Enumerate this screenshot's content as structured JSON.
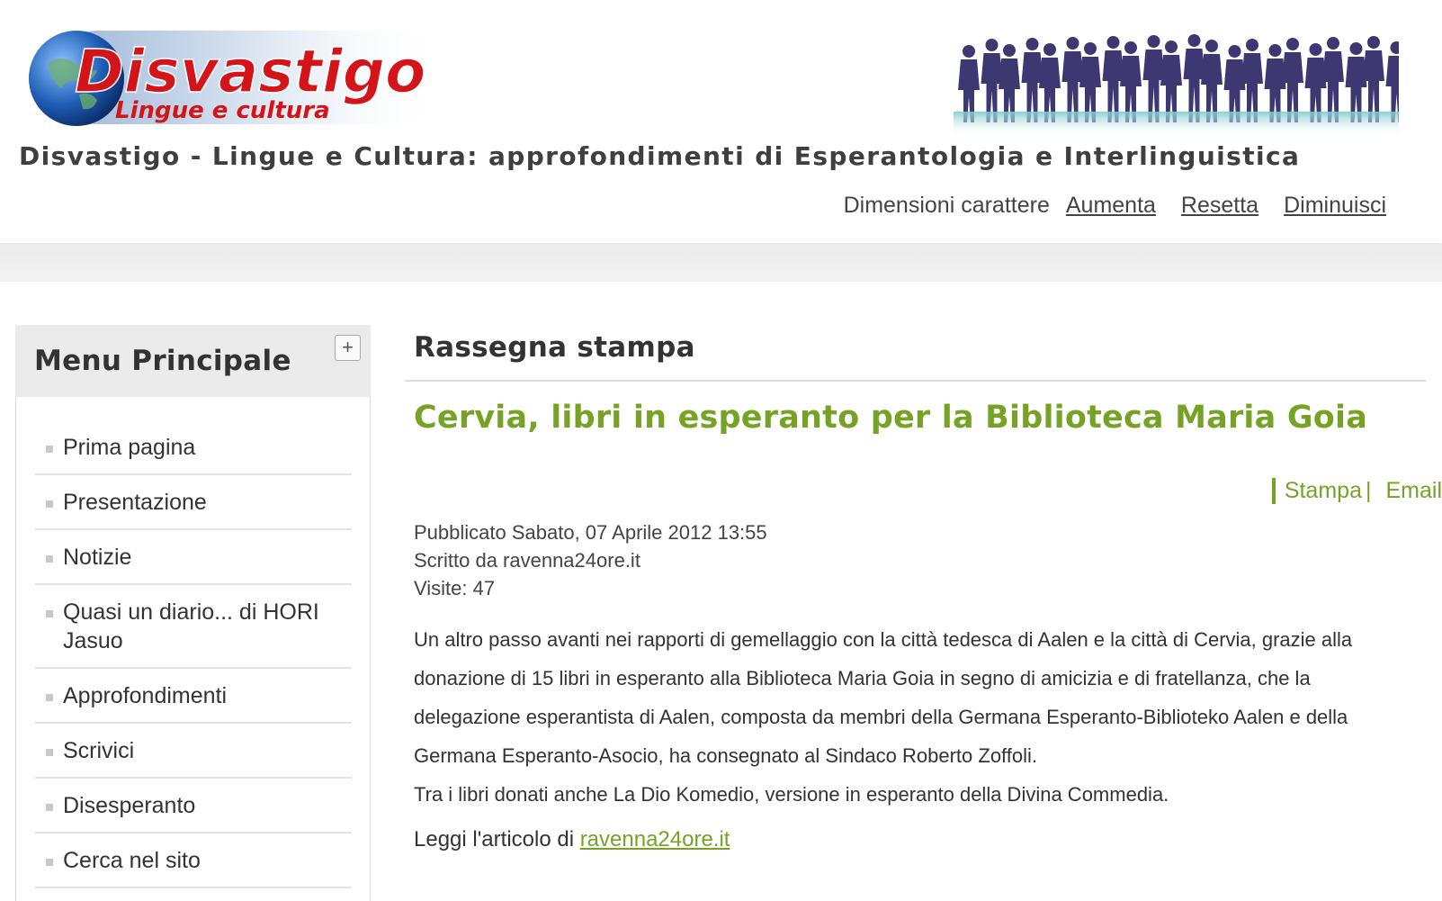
{
  "header": {
    "logo": {
      "brand": "Disvastigo",
      "subtitle": "Lingue e cultura"
    },
    "tagline": "Disvastigo - Lingue e Cultura: approfondimenti di Esperantologia e Interlinguistica",
    "font_size": {
      "label": "Dimensioni carattere",
      "increase": "Aumenta",
      "reset": "Resetta",
      "decrease": "Diminuisci"
    }
  },
  "sidebar": {
    "title": "Menu Principale",
    "toggle": "+",
    "items": [
      {
        "label": "Prima pagina"
      },
      {
        "label": "Presentazione"
      },
      {
        "label": "Notizie"
      },
      {
        "label": "Quasi un diario... di HORI Jasuo"
      },
      {
        "label": "Approfondimenti"
      },
      {
        "label": "Scrivici"
      },
      {
        "label": "Disesperanto"
      },
      {
        "label": "Cerca nel sito"
      }
    ]
  },
  "main": {
    "section_title": "Rassegna stampa",
    "article": {
      "title": "Cervia, libri in esperanto per la Biblioteca Maria Goia",
      "actions": {
        "print": "Stampa",
        "separator": "|",
        "email": "Email"
      },
      "meta": {
        "published": "Pubblicato Sabato, 07 Aprile 2012 13:55",
        "author": "Scritto da ravenna24ore.it",
        "visits": "Visite: 47"
      },
      "paragraph_1": "Un altro passo avanti nei rapporti di gemellaggio con la città tedesca di Aalen e la città di Cervia, grazie alla donazione di 15 libri in esperanto alla Biblioteca Maria Goia in segno di amicizia e di fratellanza, che la delegazione esperantista di Aalen, composta da membri della Germana Esperanto-Biblioteko Aalen e della Germana Esperanto-Asocio, ha consegnato al Sindaco Roberto Zoffoli.",
      "paragraph_2": "Tra i libri donati anche La Dio Komedio, versione in esperanto della Divina Commedia.",
      "read_more_prefix": "Leggi l'articolo di ",
      "read_more_link": "ravenna24ore.it"
    }
  },
  "colors": {
    "accent_green": "#76a326",
    "logo_red": "#d31418",
    "people_purple": "#3d3872"
  }
}
